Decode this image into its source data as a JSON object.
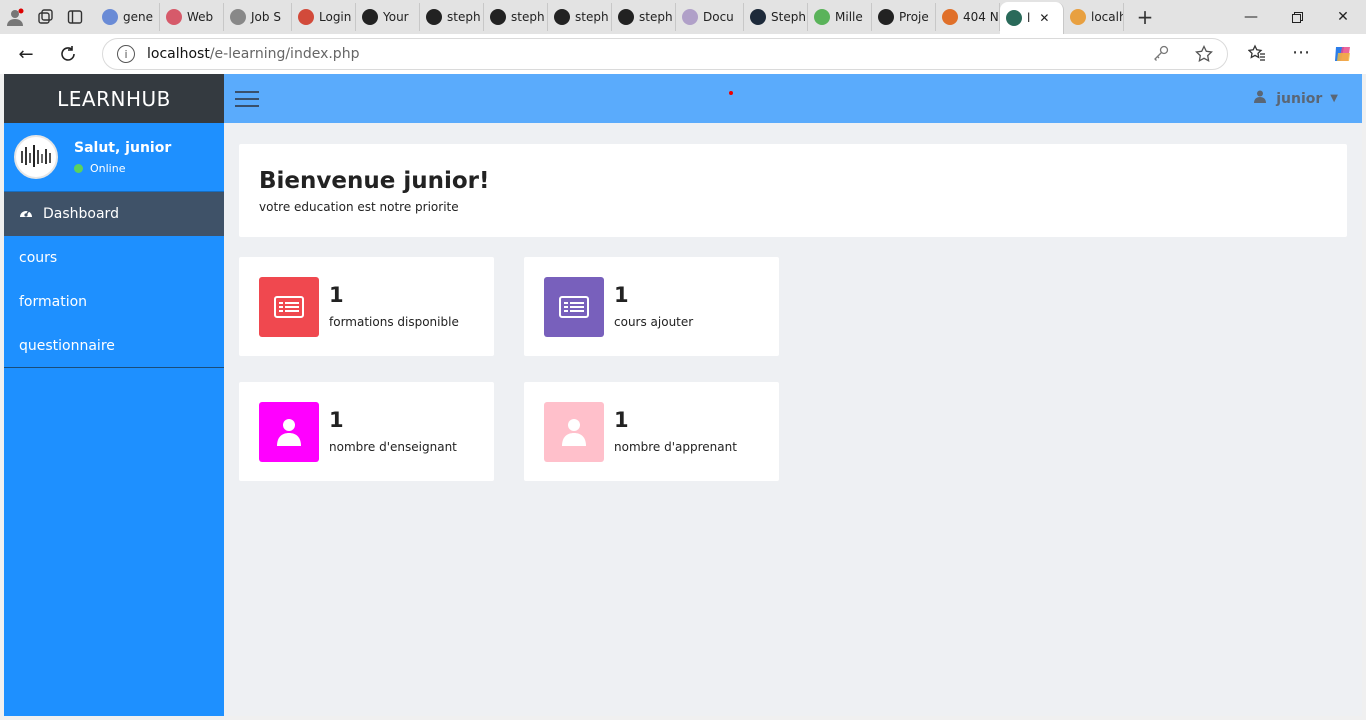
{
  "browser": {
    "tabs": [
      {
        "title": "gene",
        "color": "#6a8bd6"
      },
      {
        "title": "Web",
        "color": "#d65a6a"
      },
      {
        "title": "Job S",
        "color": "#888888"
      },
      {
        "title": "Login",
        "color": "#d24a3a"
      },
      {
        "title": "Your",
        "color": "#222222"
      },
      {
        "title": "steph",
        "color": "#222222"
      },
      {
        "title": "steph",
        "color": "#222222"
      },
      {
        "title": "steph",
        "color": "#222222"
      },
      {
        "title": "steph",
        "color": "#222222"
      },
      {
        "title": "Docu",
        "color": "#b0a0c8"
      },
      {
        "title": "Steph",
        "color": "#1d2a3a"
      },
      {
        "title": "Mille",
        "color": "#5ab35a"
      },
      {
        "title": "Proje",
        "color": "#222222"
      },
      {
        "title": "404 N",
        "color": "#e0702a"
      },
      {
        "title": "l",
        "color": "#2a6a5a"
      },
      {
        "title": "localh",
        "color": "#e8a040"
      }
    ],
    "url_host": "localhost",
    "url_path": "/e-learning/index.php"
  },
  "sidebar": {
    "brand": "LEARNHUB",
    "user_greeting": "Salut, junior",
    "user_status": "Online",
    "items": [
      {
        "label": "Dashboard",
        "active": true,
        "icon": "dashboard-icon"
      },
      {
        "label": "cours",
        "active": false
      },
      {
        "label": "formation",
        "active": false
      },
      {
        "label": "questionnaire",
        "active": false
      }
    ]
  },
  "topbar": {
    "user_label": "junior"
  },
  "welcome": {
    "title": "Bienvenue junior!",
    "subtitle": "votre education est notre priorite"
  },
  "cards": [
    {
      "value": "1",
      "label": "formations disponible",
      "color": "#f0484f",
      "icon": "list-icon"
    },
    {
      "value": "1",
      "label": "cours ajouter",
      "color": "#7860bc",
      "icon": "list-icon"
    },
    {
      "value": "1",
      "label": "nombre d'enseignant",
      "color": "#ff00ff",
      "icon": "user-icon"
    },
    {
      "value": "1",
      "label": "nombre d'apprenant",
      "color": "#ffc0cb",
      "icon": "user-icon"
    }
  ],
  "colors": {
    "sidebar_bg": "#1e90ff",
    "brand_bg": "#343a40",
    "topbar_bg": "#5aabfc",
    "active_item_bg": "#3f5268"
  }
}
